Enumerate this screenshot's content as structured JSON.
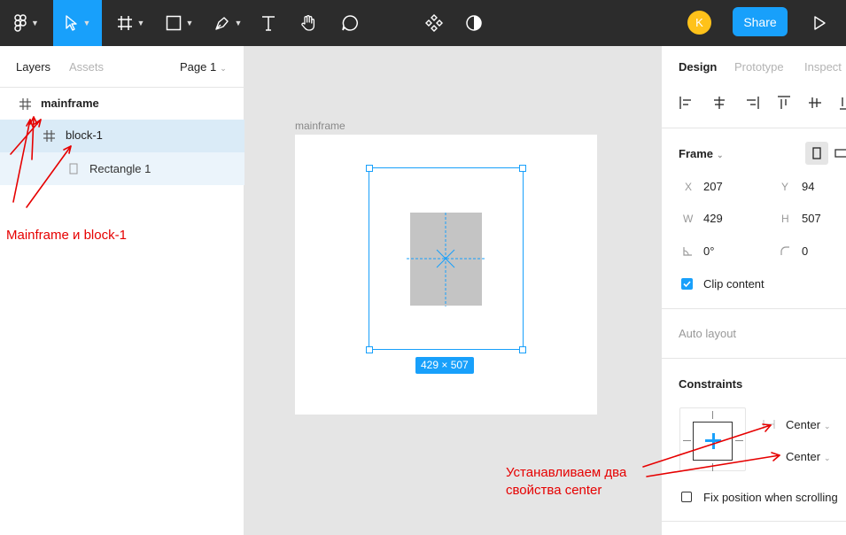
{
  "toolbar": {
    "tools": [
      "figma-menu-icon",
      "move-tool-icon",
      "frame-tool-icon",
      "shape-tool-icon",
      "pen-tool-icon",
      "text-tool-icon",
      "hand-tool-icon",
      "comment-tool-icon",
      "components-icon",
      "mask-icon"
    ],
    "avatar_initial": "K",
    "share_label": "Share",
    "accent": "#18a0fb"
  },
  "left_panel": {
    "tab_layers": "Layers",
    "tab_assets": "Assets",
    "page_selector": "Page 1",
    "layers": [
      {
        "name": "mainframe",
        "bold": true
      },
      {
        "name": "block-1",
        "selected": true
      },
      {
        "name": "Rectangle 1"
      }
    ]
  },
  "canvas": {
    "frame_label": "mainframe",
    "size_badge": "429 × 507"
  },
  "right_panel": {
    "tab_design": "Design",
    "tab_prototype": "Prototype",
    "tab_inspect": "Inspect",
    "frame_title": "Frame",
    "x_label": "X",
    "x_value": "207",
    "y_label": "Y",
    "y_value": "94",
    "w_label": "W",
    "w_value": "429",
    "h_label": "H",
    "h_value": "507",
    "rotation_value": "0°",
    "radius_value": "0",
    "clip_content": "Clip content",
    "auto_layout": "Auto layout",
    "constraints_title": "Constraints",
    "constraint_horizontal": "Center",
    "constraint_vertical": "Center",
    "fix_position": "Fix position when scrolling"
  },
  "annotations": {
    "left_note": "Mainframe и block-1",
    "right_note_line1": "Устанавливаем два",
    "right_note_line2": "свойства center",
    "color": "#e60000"
  }
}
